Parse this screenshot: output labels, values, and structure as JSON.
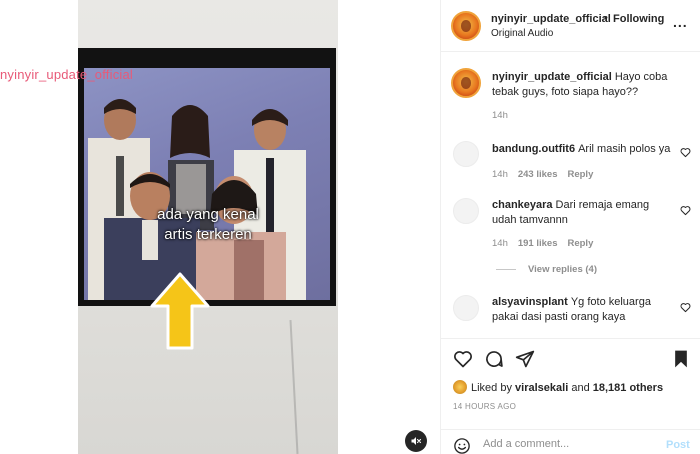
{
  "media": {
    "watermark": "nyinyir_update_official",
    "caption_line1": "ada yang kenal",
    "caption_line2": "artis terkeren",
    "mute_icon": "speaker-muted-icon"
  },
  "header": {
    "username": "nyinyir_update_official",
    "separator": "•",
    "follow_status": "Following",
    "audio": "Original Audio",
    "more_label": "..."
  },
  "caption_comment": {
    "username": "nyinyir_update_official",
    "text": "Hayo coba tebak guys, foto siapa hayo??",
    "time": "14h"
  },
  "comments": [
    {
      "username": "bandung.outfit6",
      "text": "Aril masih polos ya",
      "time": "14h",
      "likes": "243 likes",
      "reply": "Reply"
    },
    {
      "username": "chankeyara",
      "text": "Dari remaja emang udah tamvannn",
      "time": "14h",
      "likes": "191 likes",
      "reply": "Reply"
    },
    {
      "username": "alsyavinsplant",
      "text": "Yg foto keluarga pakai dasi pasti orang kaya"
    }
  ],
  "view_replies": "View replies (4)",
  "likes_summary": {
    "prefix": "Liked by",
    "user": "viralsekali",
    "middle": "and",
    "count": "18,181 others"
  },
  "timestamp": "14 HOURS AGO",
  "add_comment": {
    "placeholder": "Add a comment...",
    "post_label": "Post"
  },
  "colors": {
    "text": "#262626",
    "muted": "#8e8e8e",
    "post_disabled": "#b2dffc",
    "watermark": "#e85a78",
    "arrow": "#f5c518"
  }
}
